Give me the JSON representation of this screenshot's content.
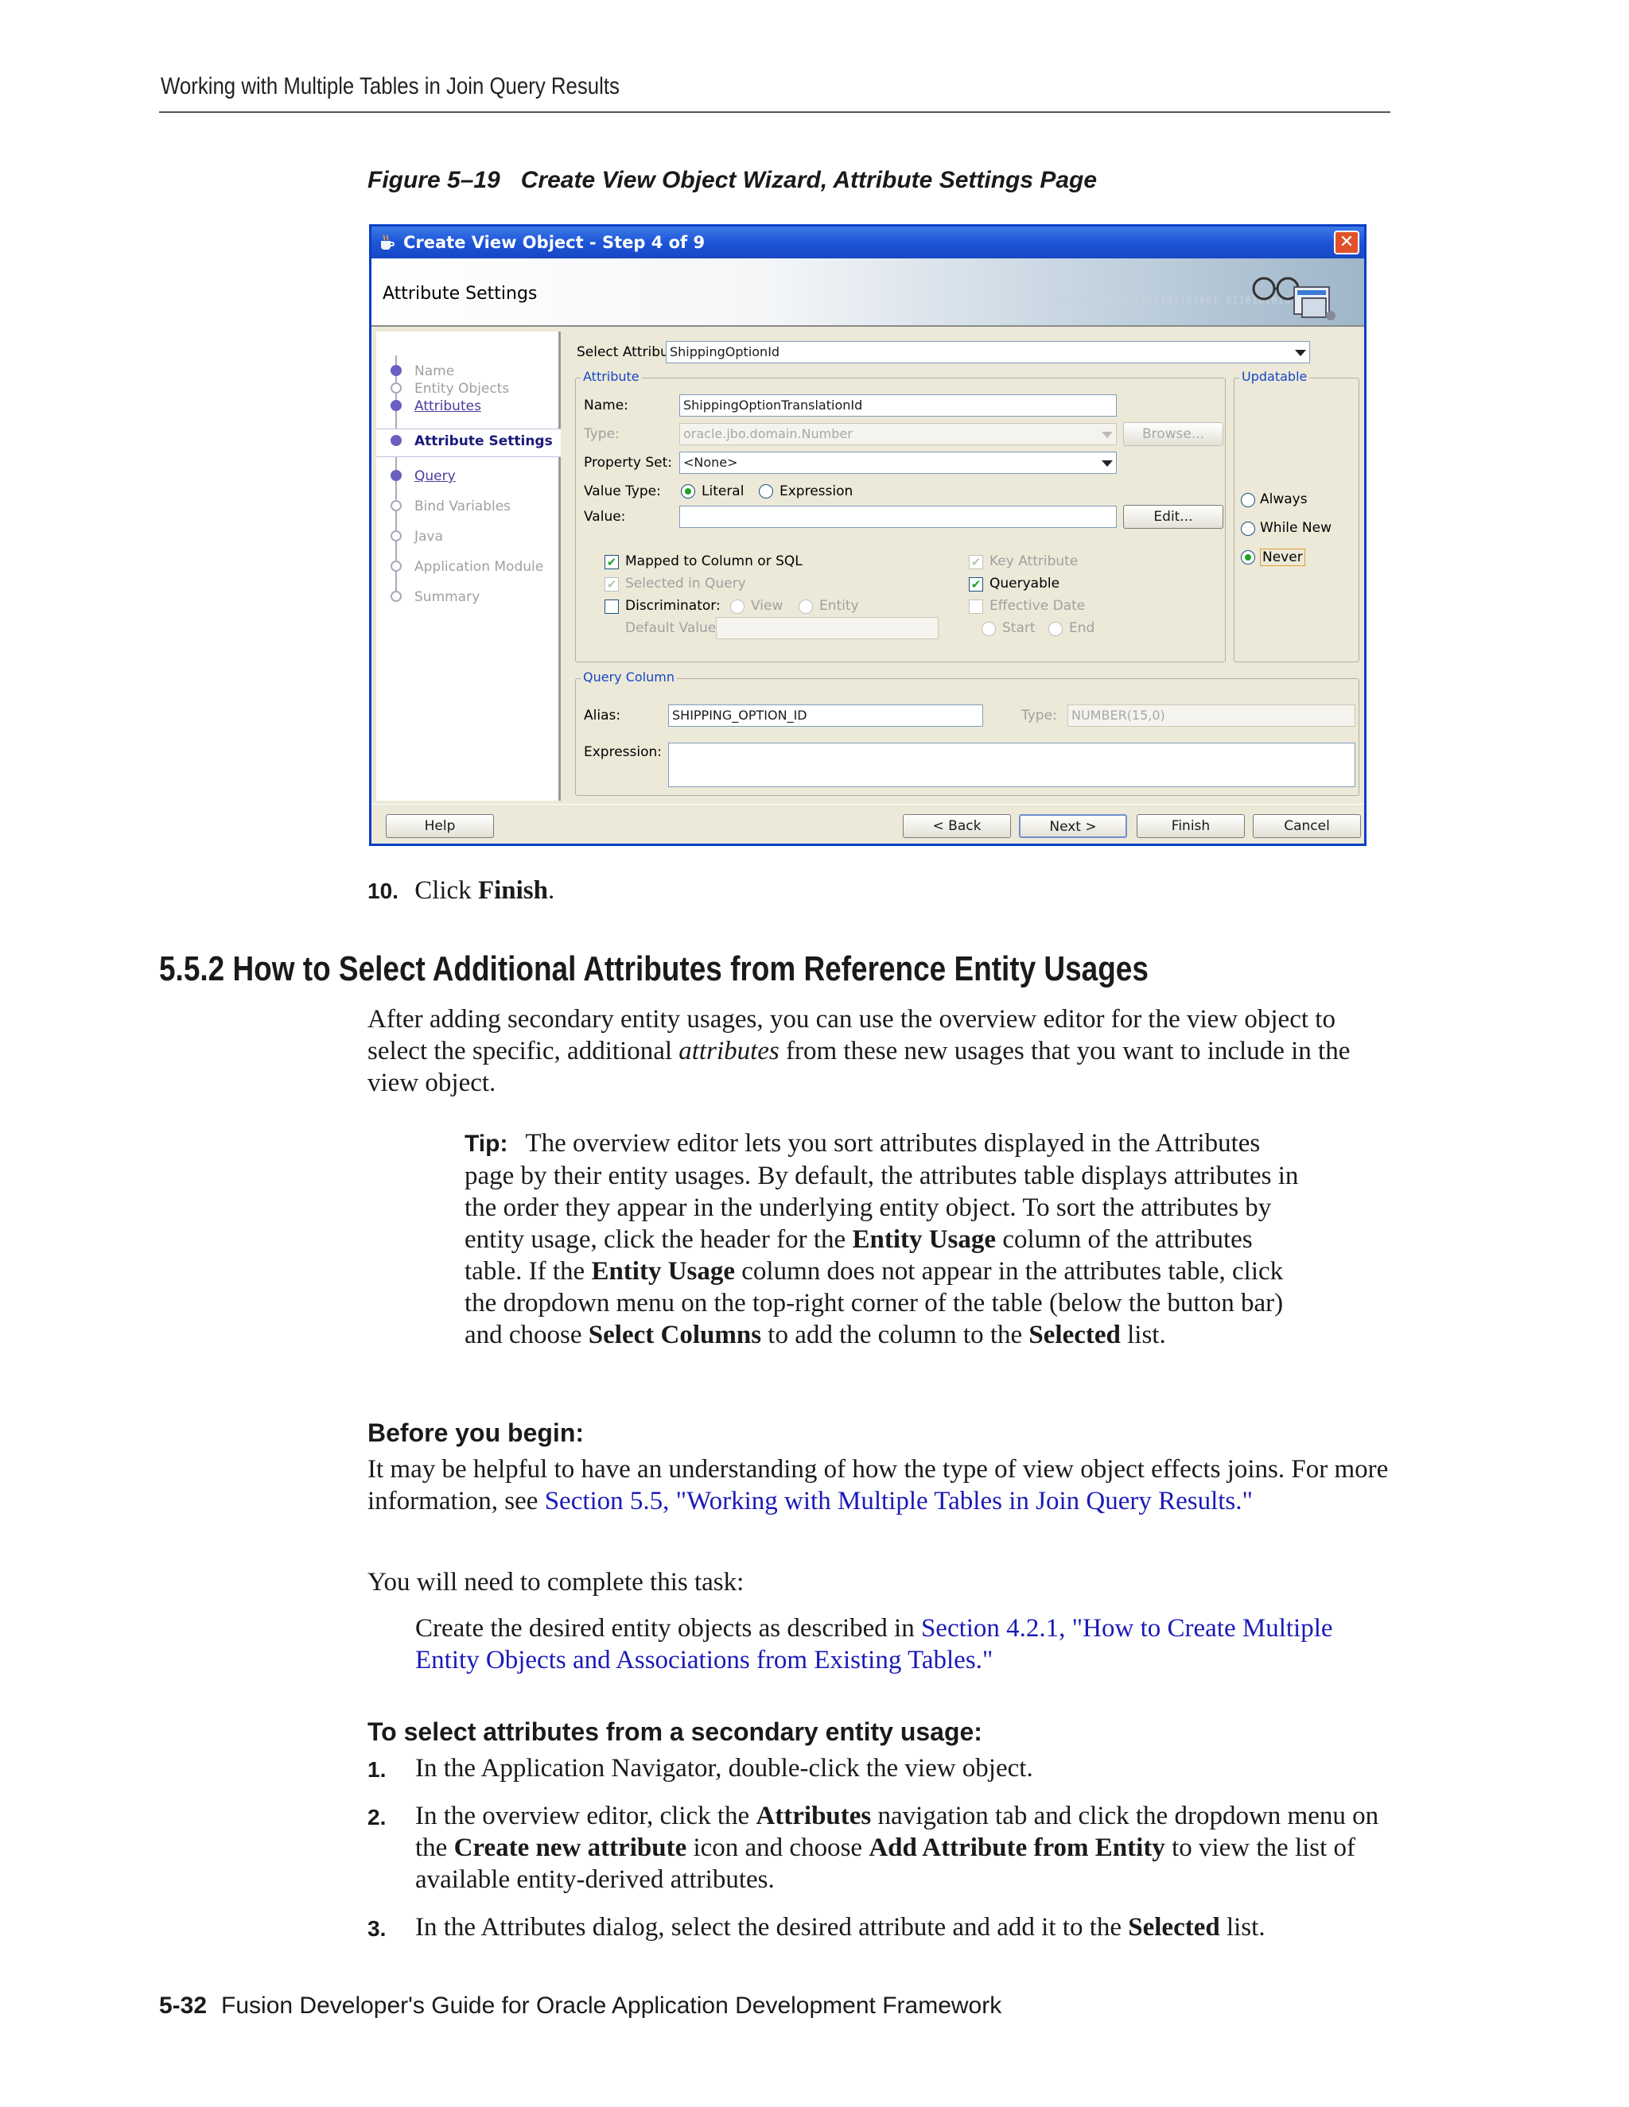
{
  "page": {
    "running_head": "Working with Multiple Tables in Join Query Results",
    "figure_number": "Figure 5–19",
    "figure_title": "Create View Object Wizard, Attribute Settings Page",
    "footer_page": "5-32",
    "footer_title": "Fusion Developer's Guide for Oracle Application Development Framework"
  },
  "dialog": {
    "title": "Create View Object - Step 4 of 9",
    "banner_title": "Attribute Settings",
    "nav": [
      "Name",
      "Entity Objects",
      "Attributes",
      "Attribute Settings",
      "Query",
      "Bind Variables",
      "Java",
      "Application Module",
      "Summary"
    ],
    "select_attribute_label": "Select Attribute:",
    "select_attribute_value": "ShippingOptionId",
    "attribute_group": "Attribute",
    "name_label": "Name:",
    "name_value": "ShippingOptionTranslationId",
    "type_label": "Type:",
    "type_value": "oracle.jbo.domain.Number",
    "browse_button": "Browse...",
    "property_set_label": "Property Set:",
    "property_set_value": "<None>",
    "value_type_label": "Value Type:",
    "literal_label": "Literal",
    "expression_label": "Expression",
    "value_label": "Value:",
    "value_value": "",
    "edit_button": "Edit...",
    "mapped_label": "Mapped to Column or SQL",
    "selected_in_query_label": "Selected in Query",
    "discriminator_label": "Discriminator:",
    "view_label": "View",
    "entity_label": "Entity",
    "default_value_label": "Default Value:",
    "key_attribute_label": "Key Attribute",
    "queryable_label": "Queryable",
    "effective_date_label": "Effective Date",
    "start_label": "Start",
    "end_label": "End",
    "updatable_group": "Updatable",
    "always_label": "Always",
    "while_new_label": "While New",
    "never_label": "Never",
    "query_column_group": "Query Column",
    "alias_label": "Alias:",
    "alias_value": "SHIPPING_OPTION_ID",
    "qc_type_label": "Type:",
    "qc_type_value": "NUMBER(15,0)",
    "expression_field_label": "Expression:",
    "help_button": "Help",
    "back_button": "< Back",
    "next_button": "Next >",
    "finish_button": "Finish",
    "cancel_button": "Cancel",
    "banner_bits": "1011101010110101101101001 0110101010"
  },
  "step10": {
    "num": "10.",
    "pre": "Click ",
    "bold": "Finish",
    "post": "."
  },
  "section": {
    "heading": "5.5.2  How to Select Additional Attributes from Reference Entity Usages",
    "intro_pre": "After adding secondary entity usages, you can use the overview editor for the view object to select the specific, additional ",
    "intro_em": "attributes",
    "intro_post": " from these new usages that you want to include in the view object.",
    "tip_label": "Tip:",
    "tip_1": "The overview editor lets you sort attributes displayed in the Attributes page by their entity usages. By default, the attributes table displays attributes in the order they appear in the underlying entity object. To sort the attributes by entity usage, click the header for the ",
    "tip_b1": "Entity Usage",
    "tip_2": " column of the attributes table. If the ",
    "tip_b2": "Entity Usage",
    "tip_3": " column does not appear in the attributes table, click the dropdown menu on the top-right corner of the table (below the button bar) and choose ",
    "tip_b3": "Select Columns",
    "tip_4": " to add the column to the ",
    "tip_b4": "Selected",
    "tip_5": " list.",
    "before_heading": "Before you begin:",
    "before_text": "It may be helpful to have an understanding of how the type of view object effects joins. For more information, see ",
    "before_link": "Section 5.5, \"Working with Multiple Tables in Join Query Results.\"",
    "task_text": "You will need to complete this task:",
    "task_pre": "Create the desired entity objects as described in ",
    "task_link": "Section 4.2.1, \"How to Create Multiple Entity Objects and Associations from Existing Tables.\"",
    "proc_heading": "To select attributes from a secondary entity usage:",
    "s1_num": "1.",
    "s1": "In the Application Navigator, double-click the view object.",
    "s2_num": "2.",
    "s2_a": "In the overview editor, click the ",
    "s2_b": "Attributes",
    "s2_c": " navigation tab and click the dropdown menu on the ",
    "s2_d": "Create new attribute",
    "s2_e": " icon and choose ",
    "s2_f": "Add Attribute from Entity",
    "s2_g": " to view the list of available entity-derived attributes.",
    "s3_num": "3.",
    "s3_a": "In the Attributes dialog, select the desired attribute and add it to the ",
    "s3_b": "Selected",
    "s3_c": " list."
  },
  "colors": {
    "title_bar": "#1c55d8",
    "link": "#1a1ab8",
    "dialog_bg": "#ece9d8"
  }
}
